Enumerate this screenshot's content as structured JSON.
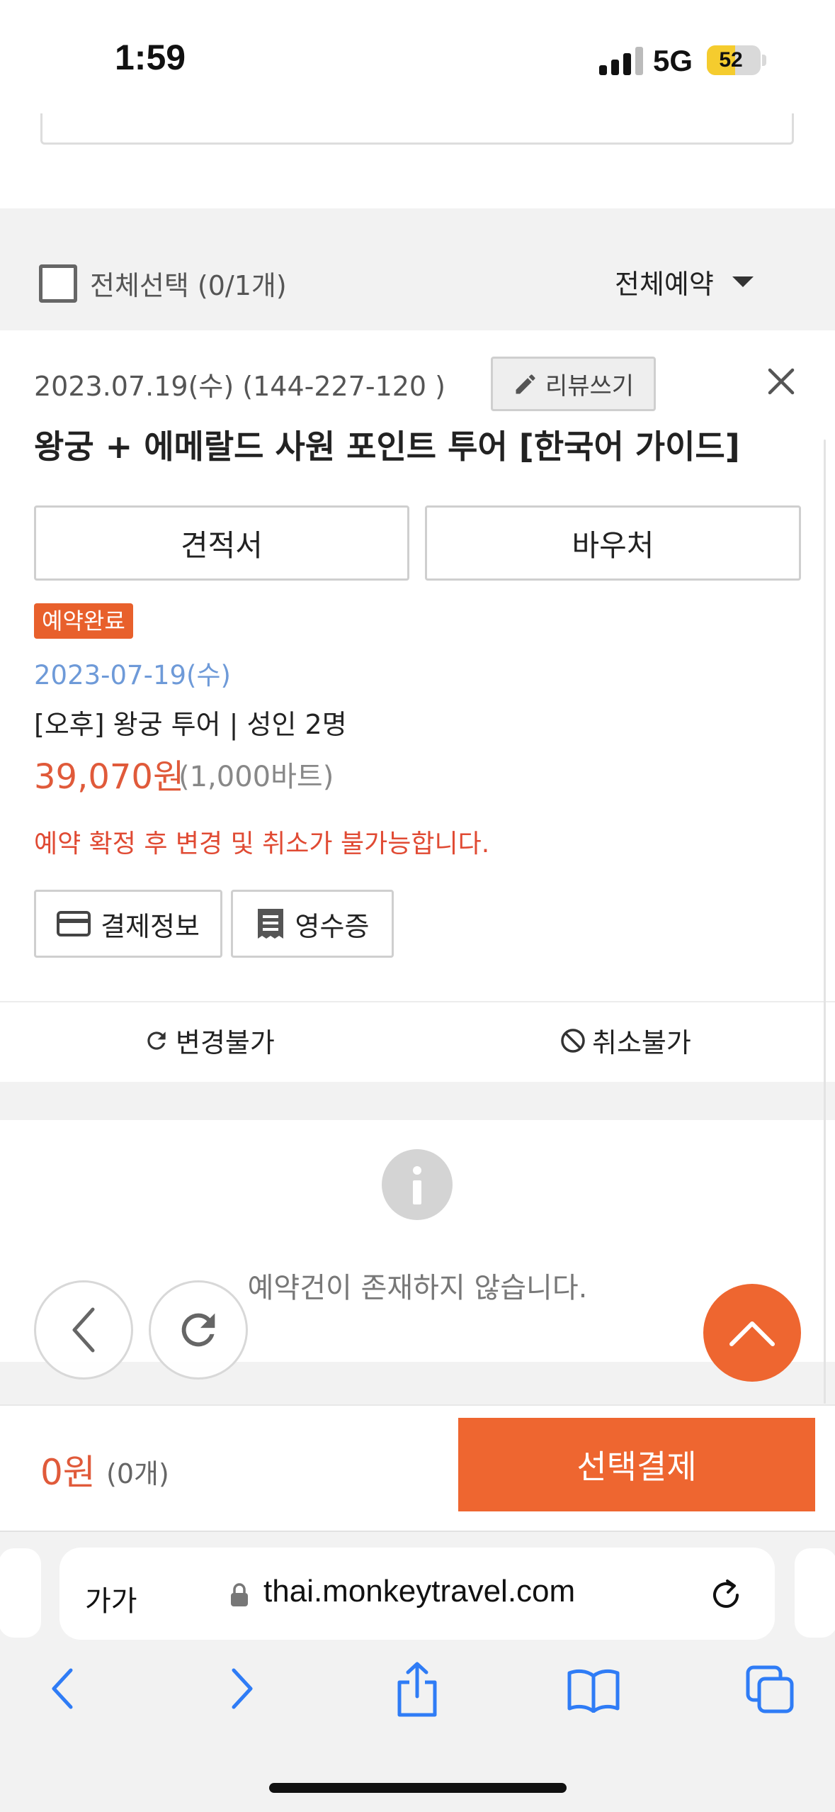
{
  "status_bar": {
    "time": "1:59",
    "network": "5G",
    "battery": "52",
    "battery_level": 0.52
  },
  "select_bar": {
    "select_all_label": "전체선택 (0/1개)",
    "filter_label": "전체예약"
  },
  "order": {
    "meta": "2023.07.19(수) (144-227-120 )",
    "review_label": "리뷰쓰기",
    "title": "왕궁 + 에메랄드 사원 포인트 투어 [한국어 가이드]",
    "quote_label": "견적서",
    "voucher_label": "바우처",
    "status_badge": "예약완료",
    "tour_date": "2023-07-19(수)",
    "option": "[오후] 왕궁 투어 | 성인 2명",
    "price": "39,070원",
    "price_local": "(1,000바트)",
    "warning": "예약 확정 후 변경 및 취소가 불가능합니다.",
    "payment_info_label": "결제정보",
    "receipt_label": "영수증",
    "change_label": "변경불가",
    "cancel_label": "취소불가"
  },
  "empty_state": {
    "text": "예약건이 존재하지 않습니다."
  },
  "pay_bar": {
    "amount": "0원",
    "count": "(0개)",
    "pay_button": "선택결제"
  },
  "browser": {
    "text_size_label": "가가",
    "url": "thai.monkeytravel.com"
  },
  "colors": {
    "accent": "#ee6630",
    "price": "#e05a3a",
    "date": "#6e9ad8",
    "ios_blue": "#2f7cf6"
  },
  "icons": [
    "pencil-icon",
    "close-icon",
    "card-icon",
    "receipt-icon",
    "refresh-icon",
    "prohibit-icon",
    "info-icon",
    "back-icon",
    "reload-icon",
    "chevron-up-icon",
    "lock-icon",
    "share-icon",
    "bookmarks-icon",
    "tabs-icon",
    "forward-icon"
  ]
}
